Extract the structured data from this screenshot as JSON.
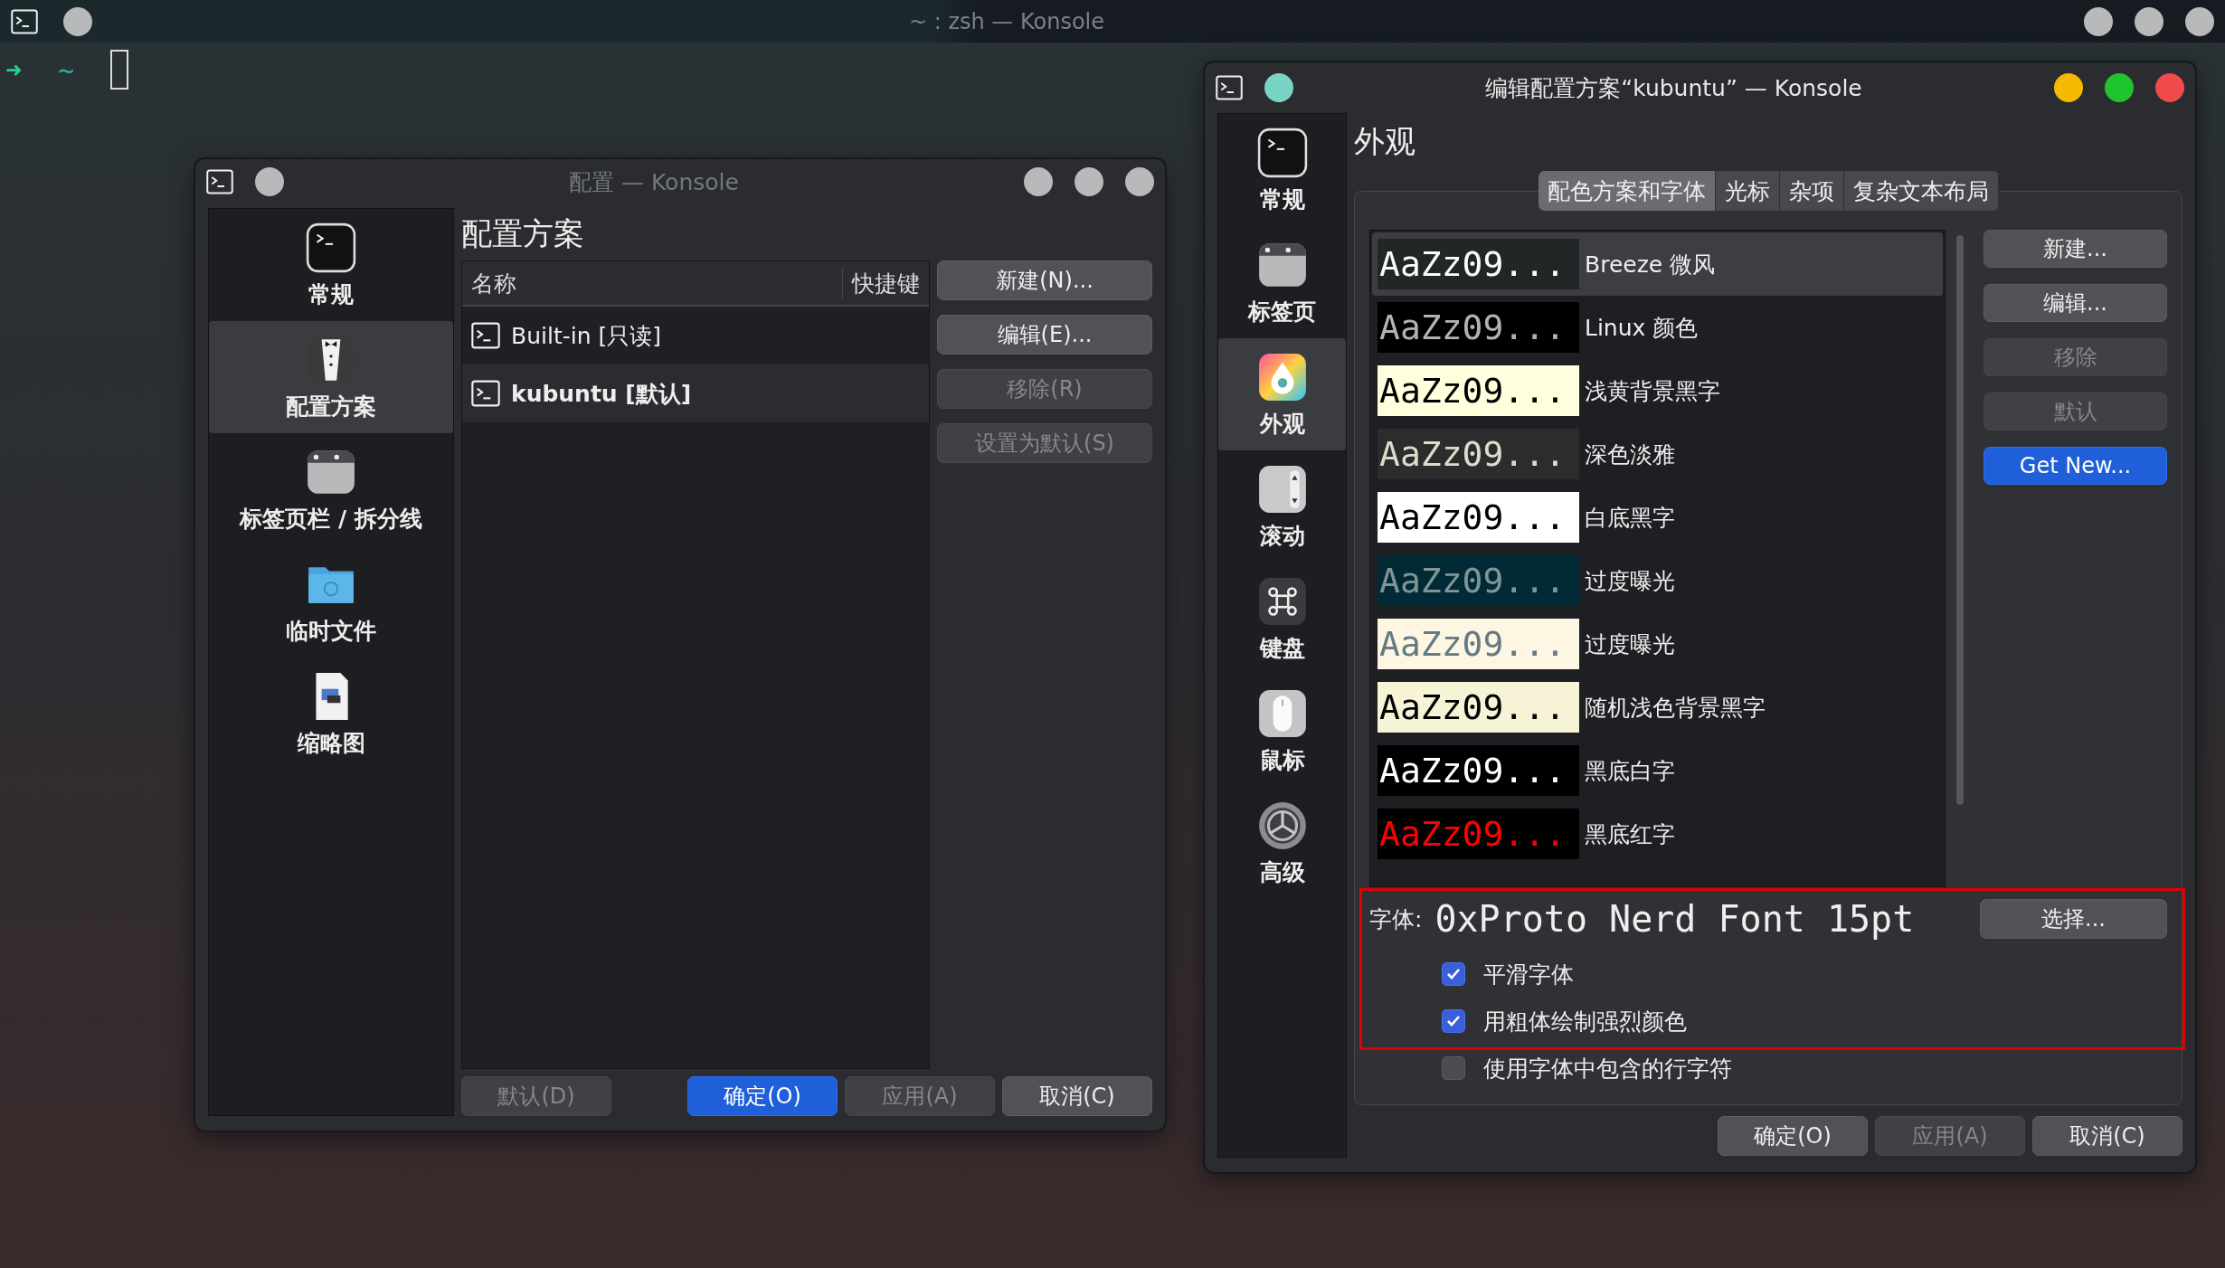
{
  "terminal": {
    "title": "~ : zsh — Konsole",
    "active": false,
    "prompt_symbol": "➜",
    "cwd": "~"
  },
  "profiles_window": {
    "title": "配置 — Konsole",
    "active": false,
    "sidebar": [
      {
        "label": "常规",
        "kind": "terminal",
        "selected": false
      },
      {
        "label": "配置方案",
        "kind": "tuxedo",
        "selected": true
      },
      {
        "label": "标签页栏 / 拆分线",
        "kind": "tabs",
        "selected": false
      },
      {
        "label": "临时文件",
        "kind": "folder",
        "selected": false
      },
      {
        "label": "缩略图",
        "kind": "image",
        "selected": false
      }
    ],
    "heading": "配置方案",
    "table": {
      "columns": [
        "名称",
        "快捷键"
      ],
      "rows": [
        {
          "name": "Built-in [只读]",
          "is_default": false,
          "selected": false
        },
        {
          "name": "kubuntu [默认]",
          "is_default": true,
          "selected": true
        }
      ]
    },
    "side_buttons": [
      {
        "label": "新建(N)...",
        "disabled": false
      },
      {
        "label": "编辑(E)...",
        "disabled": false
      },
      {
        "label": "移除(R)",
        "disabled": true
      },
      {
        "label": "设置为默认(S)",
        "disabled": true
      }
    ],
    "footer_left": {
      "label": "默认(D)",
      "disabled": true
    },
    "footer_buttons": [
      {
        "label": "确定(O)",
        "disabled": false,
        "kind": "primary"
      },
      {
        "label": "应用(A)",
        "disabled": true,
        "kind": "normal"
      },
      {
        "label": "取消(C)",
        "disabled": false,
        "kind": "normal"
      }
    ]
  },
  "edit_window": {
    "title": "编辑配置方案“kubuntu” — Konsole",
    "active": true,
    "sidebar": [
      {
        "label": "常规",
        "kind": "terminal",
        "selected": false
      },
      {
        "label": "标签页",
        "kind": "tabs",
        "selected": false
      },
      {
        "label": "外观",
        "kind": "palette",
        "selected": true
      },
      {
        "label": "滚动",
        "kind": "scroll",
        "selected": false
      },
      {
        "label": "键盘",
        "kind": "keyboard",
        "selected": false
      },
      {
        "label": "鼠标",
        "kind": "mouse",
        "selected": false
      },
      {
        "label": "高级",
        "kind": "gear",
        "selected": false
      }
    ],
    "heading": "外观",
    "tabs": [
      {
        "label": "配色方案和字体",
        "selected": true
      },
      {
        "label": "光标",
        "selected": false
      },
      {
        "label": "杂项",
        "selected": false
      },
      {
        "label": "复杂文本布局",
        "selected": false
      }
    ],
    "color_schemes": [
      {
        "preview": {
          "text": "AaZz09...",
          "color": "#fcfcfc"
        },
        "name": "Breeze 微风",
        "color": "#232627",
        "selected": true
      },
      {
        "preview": {
          "text": "AaZz09...",
          "color": "#b2b2b2"
        },
        "name": "Linux 颜色",
        "color": "#000000",
        "selected": false
      },
      {
        "preview": {
          "text": "AaZz09...",
          "color": "#000000"
        },
        "name": "浅黄背景黑字",
        "color": "#ffffdd",
        "selected": false
      },
      {
        "preview": {
          "text": "AaZz09...",
          "color": "#dcdccc"
        },
        "name": "深色淡雅",
        "color": "#2c2c2c",
        "selected": false
      },
      {
        "preview": {
          "text": "AaZz09...",
          "color": "#000000"
        },
        "name": "白底黑字",
        "color": "#ffffff",
        "selected": false
      },
      {
        "preview": {
          "text": "AaZz09...",
          "color": "#839496"
        },
        "name": "过度曝光",
        "color": "#002b36",
        "selected": false
      },
      {
        "preview": {
          "text": "AaZz09...",
          "color": "#657b83"
        },
        "name": "过度曝光",
        "color": "#fdf6e3",
        "selected": false
      },
      {
        "preview": {
          "text": "AaZz09...",
          "color": "#000000"
        },
        "name": "随机浅色背景黑字",
        "color": "#f6f3d6",
        "selected": false
      },
      {
        "preview": {
          "text": "AaZz09...",
          "color": "#ffffff"
        },
        "name": "黑底白字",
        "color": "#000000",
        "selected": false
      },
      {
        "preview": {
          "text": "AaZz09...",
          "color": "#ff0000"
        },
        "name": "黑底红字",
        "color": "#000000",
        "selected": false
      }
    ],
    "scheme_buttons": [
      {
        "label": "新建...",
        "disabled": false,
        "kind": "normal"
      },
      {
        "label": "编辑...",
        "disabled": false,
        "kind": "normal"
      },
      {
        "label": "移除",
        "disabled": true,
        "kind": "normal"
      },
      {
        "label": "默认",
        "disabled": true,
        "kind": "normal"
      },
      {
        "label": "Get New...",
        "disabled": false,
        "kind": "primary"
      }
    ],
    "font": {
      "label": "字体:",
      "value": "0xProto Nerd Font 15pt",
      "button": "选择..."
    },
    "options": [
      {
        "label": "平滑字体",
        "checked": true
      },
      {
        "label": "用粗体绘制强烈颜色",
        "checked": true
      },
      {
        "label": "使用字体中包含的行字符",
        "checked": false
      }
    ],
    "highlight": true,
    "footer_buttons": [
      {
        "label": "确定(O)",
        "disabled": false
      },
      {
        "label": "应用(A)",
        "disabled": true
      },
      {
        "label": "取消(C)",
        "disabled": false
      }
    ]
  }
}
